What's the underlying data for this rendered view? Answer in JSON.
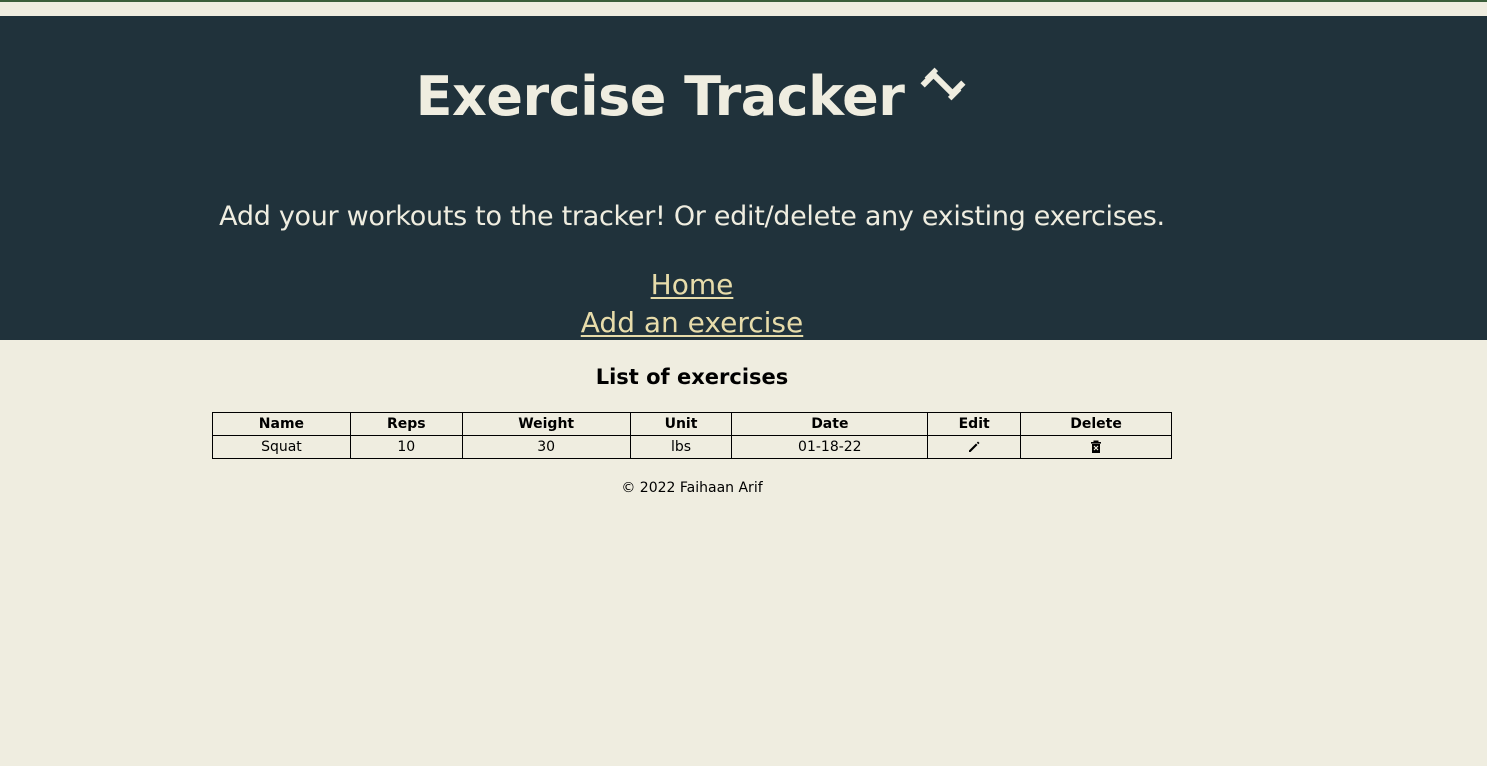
{
  "header": {
    "title": "Exercise Tracker",
    "title_icon": "dumbbell-icon",
    "subtitle": "Add your workouts to the tracker! Or edit/delete any existing exercises."
  },
  "nav": {
    "home_label": "Home",
    "add_label": "Add an exercise"
  },
  "main": {
    "list_title": "List of exercises",
    "table": {
      "columns": [
        "Name",
        "Reps",
        "Weight",
        "Unit",
        "Date",
        "Edit",
        "Delete"
      ],
      "rows": [
        {
          "name": "Squat",
          "reps": "10",
          "weight": "30",
          "unit": "lbs",
          "date": "01-18-22",
          "edit_icon": "pencil-icon",
          "delete_icon": "trash-icon"
        }
      ]
    }
  },
  "footer": {
    "copyright": "© 2022 Faihaan Arif"
  },
  "colors": {
    "header_bg": "#20323b",
    "page_bg": "#efede0",
    "header_text": "#efede0",
    "link": "#e7dcaa",
    "top_border": "#3b5e3a"
  }
}
